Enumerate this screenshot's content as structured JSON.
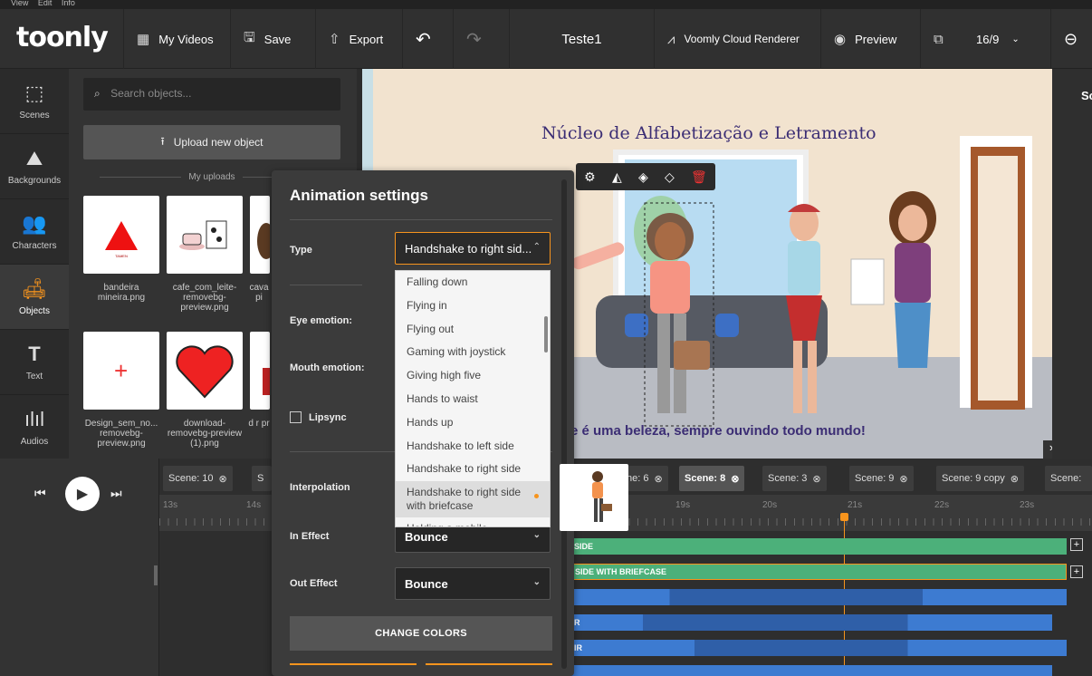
{
  "menubar": {
    "items": [
      "View",
      "Edit",
      "Info"
    ]
  },
  "topbar": {
    "logo": "toonly",
    "my_videos": "My Videos",
    "save": "Save",
    "export": "Export",
    "title": "Teste1",
    "renderer": "Voomly Cloud Renderer",
    "preview": "Preview",
    "ratio": "16/9"
  },
  "sidebar": {
    "items": [
      {
        "label": "Scenes",
        "icon": "scenes-icon"
      },
      {
        "label": "Backgrounds",
        "icon": "backgrounds-icon"
      },
      {
        "label": "Characters",
        "icon": "characters-icon"
      },
      {
        "label": "Objects",
        "icon": "objects-icon"
      },
      {
        "label": "Text",
        "icon": "text-icon"
      },
      {
        "label": "Audios",
        "icon": "audios-icon"
      }
    ]
  },
  "objects": {
    "search_placeholder": "Search objects...",
    "upload": "Upload new object",
    "my_uploads": "My uploads",
    "tiles": [
      {
        "label": "bandeira mineira.png"
      },
      {
        "label": "cafe_com_leite-removebg-preview.png"
      },
      {
        "label": "cava pi"
      },
      {
        "label": "Design_sem_no... removebg-preview.png"
      },
      {
        "label": "download-removebg-preview (1).png"
      },
      {
        "label": "d r pr"
      }
    ]
  },
  "canvas": {
    "title": "Núcleo de Alfabetização e Letramento",
    "caption": "e é uma beleza, sempre ouvindo todo mundo!"
  },
  "right_panel": {
    "label": "Sc"
  },
  "timeline": {
    "tabs": [
      "Scene: 10",
      "S",
      "ne: 6",
      "Scene: 8",
      "Scene: 3",
      "Scene: 9",
      "Scene: 9 copy",
      "Scene:"
    ],
    "ruler_left": [
      "13s",
      "14s"
    ],
    "ruler_right": [
      "19s",
      "20s",
      "21s",
      "22s",
      "23s"
    ],
    "bars": [
      "SIDE",
      "SIDE WITH BRIEFCASE",
      "",
      "R",
      "IR"
    ]
  },
  "dialog": {
    "title": "Animation settings",
    "type_label": "Type",
    "type_value": "Handshake to right sid...",
    "eye_label": "Eye emotion:",
    "mouth_label": "Mouth emotion:",
    "lipsync_label": "Lipsync",
    "interpolation_label": "Interpolation",
    "in_label": "In Effect",
    "in_value": "Bounce",
    "out_label": "Out Effect",
    "out_value": "Bounce",
    "change_colors": "CHANGE COLORS"
  },
  "dropdown": {
    "items": [
      "Falling down",
      "Flying in",
      "Flying out",
      "Gaming with joystick",
      "Giving high five",
      "Hands to waist",
      "Hands up",
      "Handshake to left side",
      "Handshake to right side",
      "Handshake to right side with briefcase",
      "Holding a mobile"
    ]
  },
  "colors": {
    "accent": "#f7941d",
    "green_bar": "#4cb07a",
    "blue_bar": "#3d7bd1"
  }
}
